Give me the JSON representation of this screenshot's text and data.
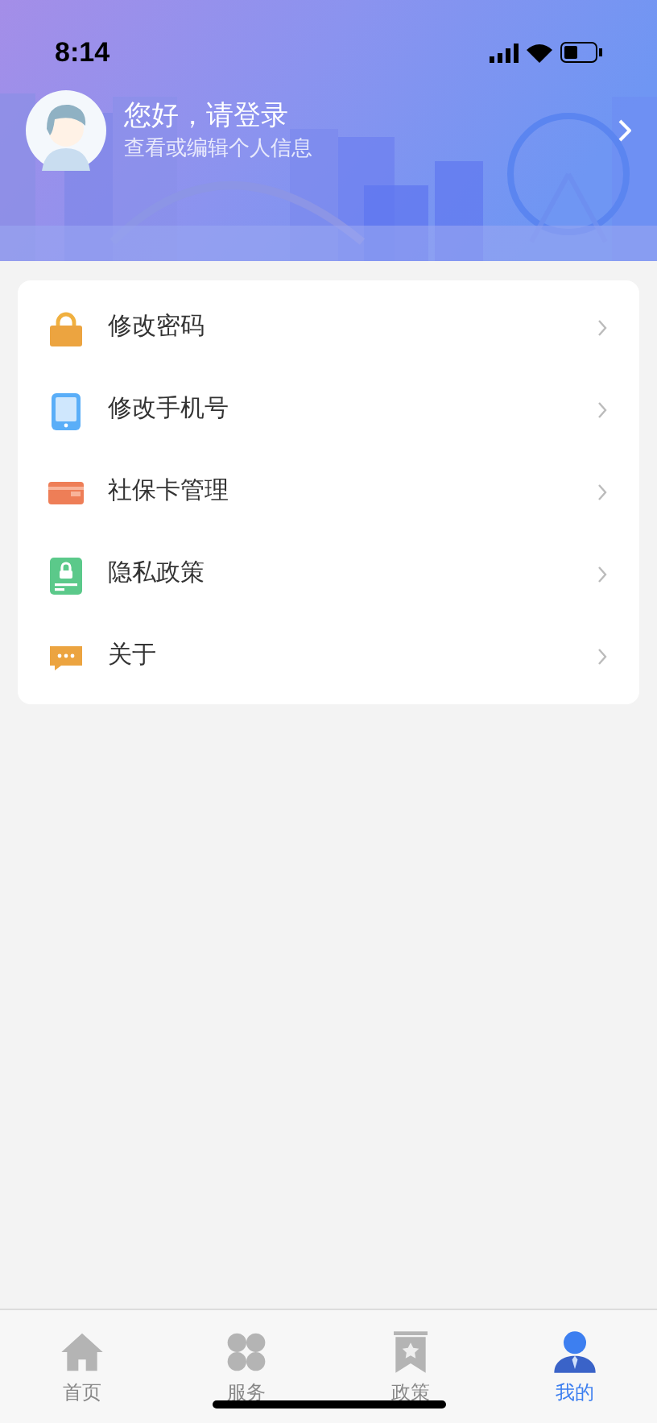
{
  "status_bar": {
    "time": "8:14"
  },
  "profile": {
    "greeting": "您好，请登录",
    "subtitle": "查看或编辑个人信息"
  },
  "menu": [
    {
      "kind": "lock",
      "label": "修改密码"
    },
    {
      "kind": "phone",
      "label": "修改手机号"
    },
    {
      "kind": "card",
      "label": "社保卡管理"
    },
    {
      "kind": "policy",
      "label": "隐私政策"
    },
    {
      "kind": "chat",
      "label": "关于"
    }
  ],
  "tab_bar": [
    {
      "kind": "home",
      "label": "首页",
      "selected": false
    },
    {
      "kind": "services",
      "label": "服务",
      "selected": false
    },
    {
      "kind": "policy",
      "label": "政策",
      "selected": false
    },
    {
      "kind": "me",
      "label": "我的",
      "selected": true
    }
  ]
}
